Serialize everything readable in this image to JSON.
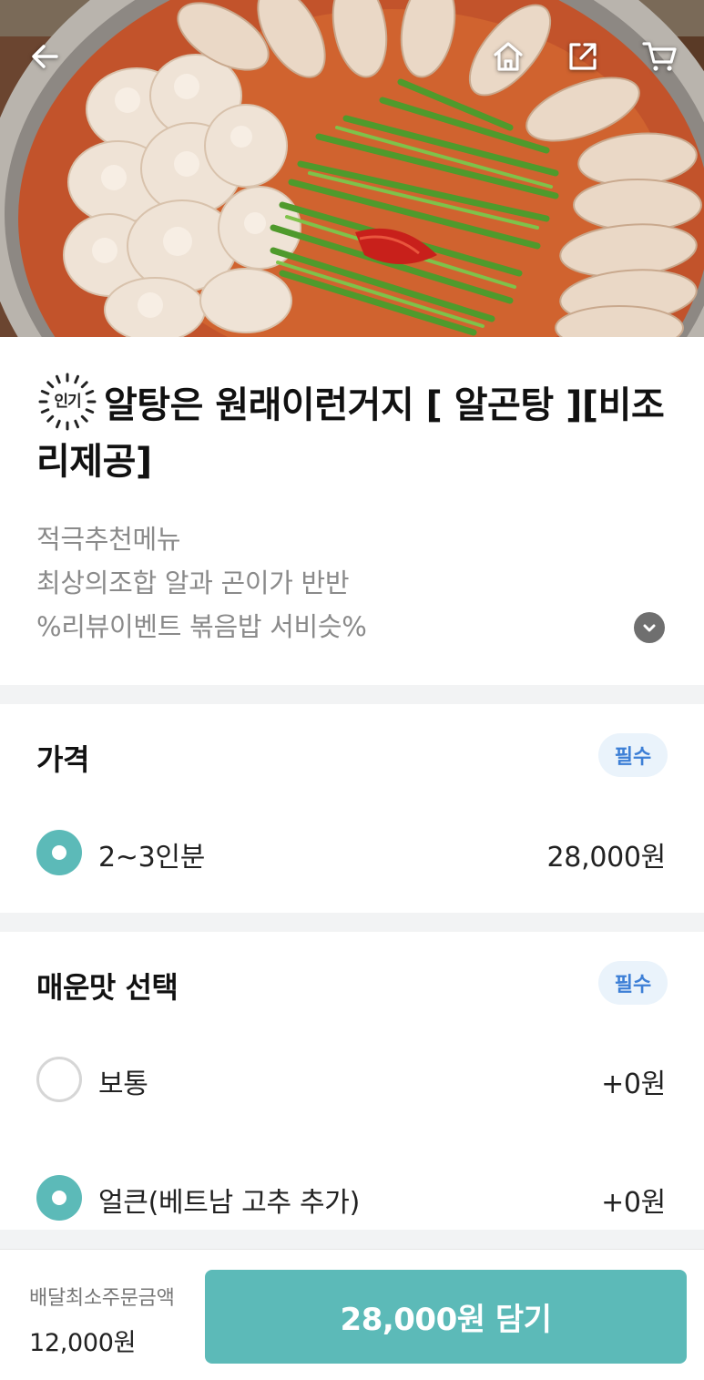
{
  "nav": {
    "back_icon": "arrow-left-icon",
    "home_icon": "home-icon",
    "share_icon": "share-icon",
    "cart_icon": "cart-icon"
  },
  "menu": {
    "badge": "인기",
    "title": "알탕은 원래이런거지 [ 알곤탕 ][비조리제공]",
    "description_lines": [
      "적극추천메뉴",
      "최상의조합 알과 곤이가 반반",
      "%리뷰이벤트 볶음밥 서비슷%"
    ],
    "expand_icon": "chevron-down-icon"
  },
  "sections": [
    {
      "title": "가격",
      "required": "필수",
      "options": [
        {
          "label": "2~3인분",
          "price": "28,000원",
          "selected": true
        }
      ]
    },
    {
      "title": "매운맛 선택",
      "required": "필수",
      "options": [
        {
          "label": "보통",
          "price": "+0원",
          "selected": false
        },
        {
          "label": "얼큰(베트남 고추 추가)",
          "price": "+0원",
          "selected": true
        }
      ]
    }
  ],
  "bottom": {
    "min_order_label": "배달최소주문금액",
    "min_order_value": "12,000원",
    "add_button": "28,000원 담기"
  },
  "colors": {
    "accent": "#5cbab8",
    "required_badge_bg": "#eaf3fb",
    "required_badge_text": "#3d7fd6",
    "divider": "#f2f3f4"
  }
}
